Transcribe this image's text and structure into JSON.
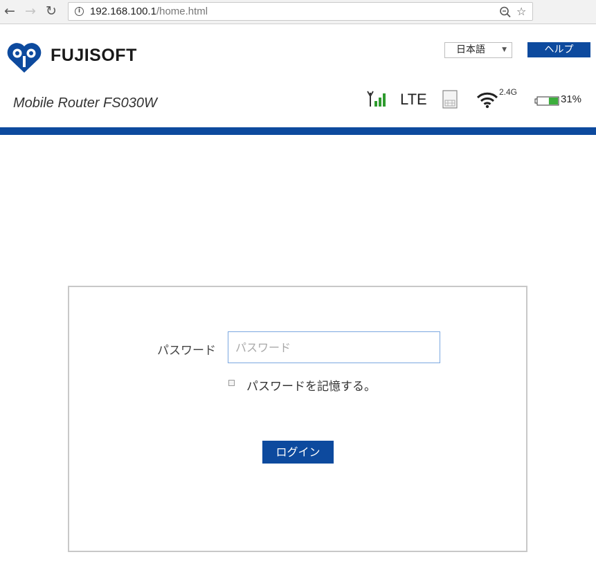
{
  "browser": {
    "url_host": "192.168.100.1",
    "url_path": "/home.html",
    "back_icon": "arrow-left-icon",
    "forward_icon": "arrow-right-icon",
    "reload_icon": "reload-icon",
    "zoom_icon": "zoom-icon",
    "bookmark_icon": "star-icon"
  },
  "header": {
    "logo_text": "FUJISOFT",
    "language_selected": "日本語",
    "help_label": "ヘルプ",
    "model_name": "Mobile Router FS030W",
    "brand_color": "#0d4a9e"
  },
  "status": {
    "network_type": "LTE",
    "wifi_band": "2.4G",
    "battery_percent": "31%",
    "battery_level": 0.31
  },
  "login": {
    "password_label": "パスワード",
    "password_placeholder": "パスワード",
    "password_value": "",
    "remember_label": "パスワードを記憶する。",
    "remember_checked": false,
    "login_button_label": "ログイン"
  }
}
